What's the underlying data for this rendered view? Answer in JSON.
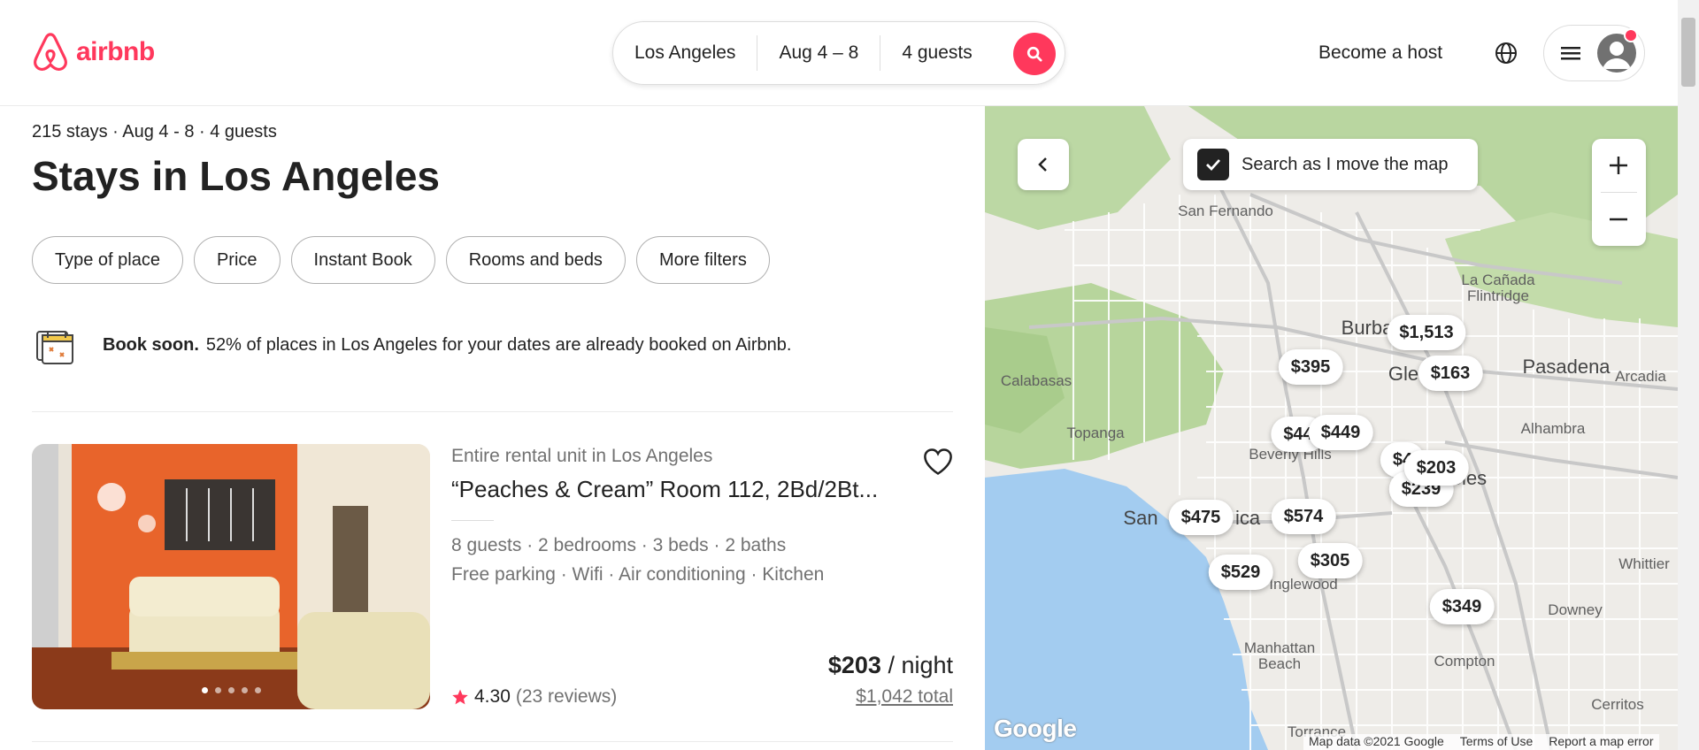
{
  "header": {
    "brand": "airbnb",
    "brand_color": "#ff385c",
    "search": {
      "location": "Los Angeles",
      "dates": "Aug 4 – 8",
      "guests": "4 guests"
    },
    "become_host": "Become a host",
    "icons": {
      "search": "search-icon",
      "globe": "globe-icon",
      "menu": "hamburger-icon",
      "user": "user-avatar-icon"
    }
  },
  "results": {
    "summary": "215 stays · Aug 4 - 8 · 4 guests",
    "title": "Stays in Los Angeles",
    "filters": [
      "Type of place",
      "Price",
      "Instant Book",
      "Rooms and beds",
      "More filters"
    ],
    "book_soon": {
      "bold": "Book soon.",
      "text": "52% of places in Los Angeles for your dates are already booked on Airbnb."
    }
  },
  "listing": {
    "type": "Entire rental unit in Los Angeles",
    "name": "“Peaches & Cream” Room 112, 2Bd/2Bt...",
    "features": "8 guests · 2 bedrooms · 3 beds · 2 baths",
    "amenities": "Free parking · Wifi · Air conditioning · Kitchen",
    "rating": "4.30",
    "reviews": "(23 reviews)",
    "price": "$203",
    "per": " / night",
    "total": "$1,042 total",
    "photo_count": 5,
    "active_photo": 1
  },
  "map": {
    "search_as_move": "Search as I move the map",
    "pins": [
      "$1,513",
      "$395",
      "$163",
      "$449",
      "$4",
      "$203",
      "$239",
      "$475",
      "$574",
      "$305",
      "$529",
      "$349",
      "$44"
    ],
    "places": [
      "San Fernando",
      "Burba",
      "La Cañada Flintridge",
      "Pasadena",
      "Arcadia",
      "Calabasas",
      "Gle",
      "Alhambra",
      "Topanga",
      "Beverly Hills",
      "eles",
      "San",
      "ica",
      "Inglewood",
      "Whittier",
      "Downey",
      "Manhattan Beach",
      "Compton",
      "Cerritos",
      "Torrance"
    ],
    "google": "Google",
    "attribution": [
      "Map data ©2021 Google",
      "Terms of Use",
      "Report a map error"
    ]
  }
}
